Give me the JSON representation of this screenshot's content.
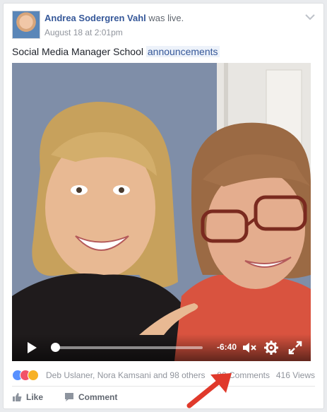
{
  "post": {
    "author_name": "Andrea Sodergren Vahl",
    "action": "was live.",
    "timestamp": "August 18 at 2:01pm",
    "text": "Social Media Manager School",
    "hashtag": "announcements"
  },
  "video": {
    "time_remaining": "-6:40",
    "progress": 0.03
  },
  "stats": {
    "reactors": "Deb Uslaner, Nora Kamsani and 98 others",
    "comments": "80 Comments",
    "views": "416 Views"
  },
  "actions": {
    "like_label": "Like",
    "comment_label": "Comment"
  },
  "icons": {
    "chevron": "chevron-down-icon",
    "play": "play-icon",
    "mute": "mute-icon",
    "settings": "gear-icon",
    "fullscreen": "fullscreen-icon",
    "like": "thumbs-up-icon",
    "comment": "comment-bubble-icon"
  },
  "colors": {
    "link": "#365899",
    "annotation_arrow": "#e0392b"
  }
}
